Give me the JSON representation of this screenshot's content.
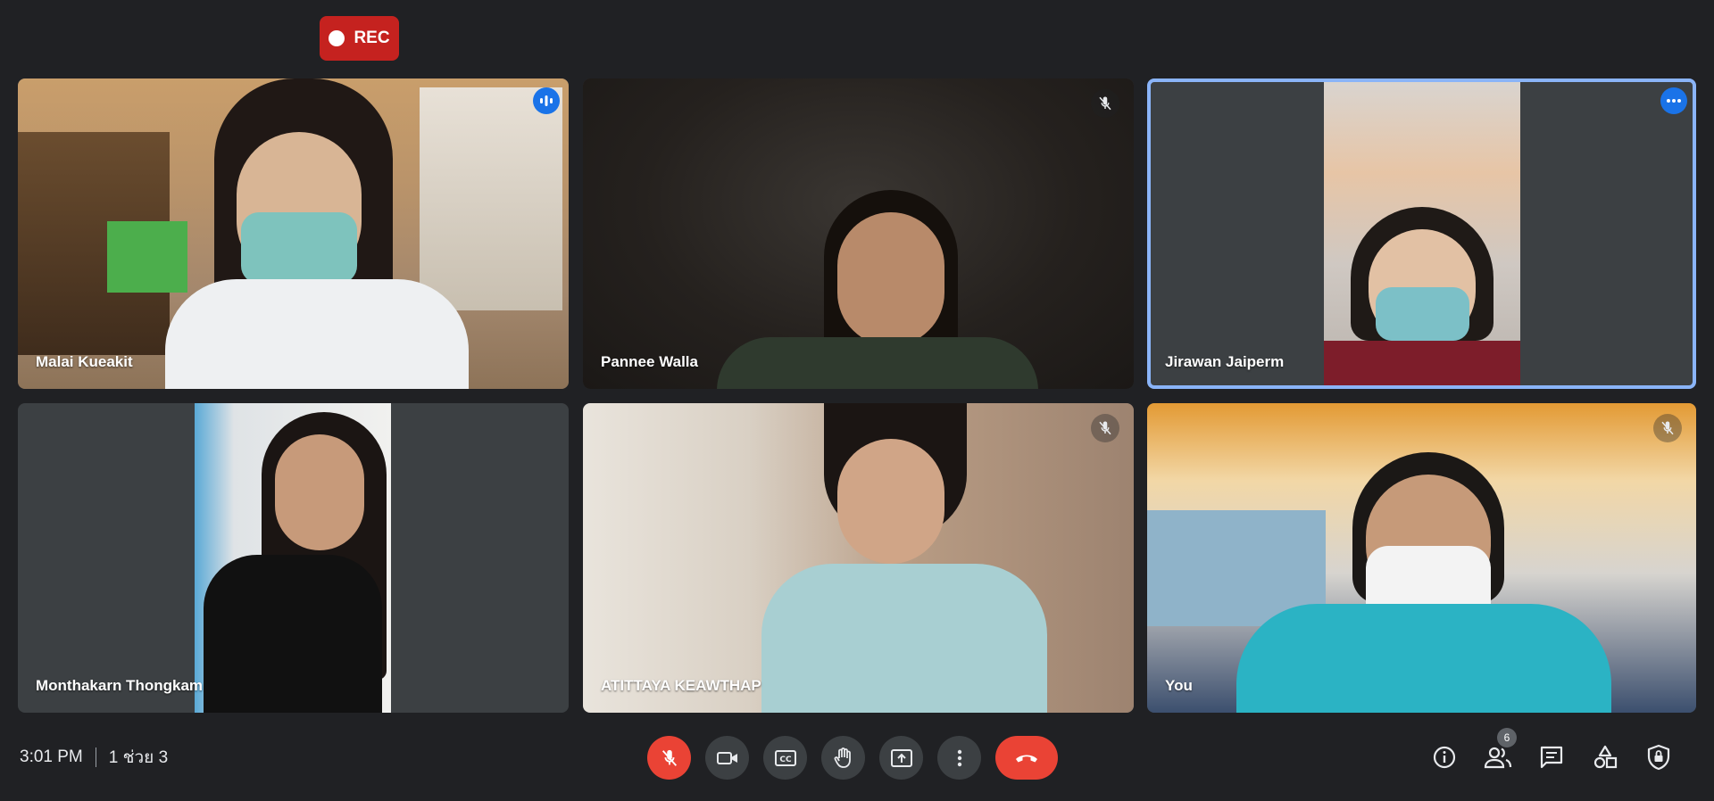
{
  "recording": {
    "label": "REC"
  },
  "participants": [
    {
      "name": "Malai Kueakit"
    },
    {
      "name": "Pannee Walla"
    },
    {
      "name": "Jirawan Jaiperm"
    },
    {
      "name": "Monthakarn Thongkam"
    },
    {
      "name": "ATITTAYA KEAWTHAP"
    },
    {
      "name": "You"
    }
  ],
  "bottom_bar": {
    "time": "3:01 PM",
    "meeting_name": "1 ช่วย 3",
    "people_count": "6"
  },
  "colors": {
    "background": "#202124",
    "tile_empty": "#3c4043",
    "accent_blue": "#1a73e8",
    "active_border": "#8ab4f8",
    "danger_red": "#ea4335",
    "rec_red": "#c5221f"
  }
}
